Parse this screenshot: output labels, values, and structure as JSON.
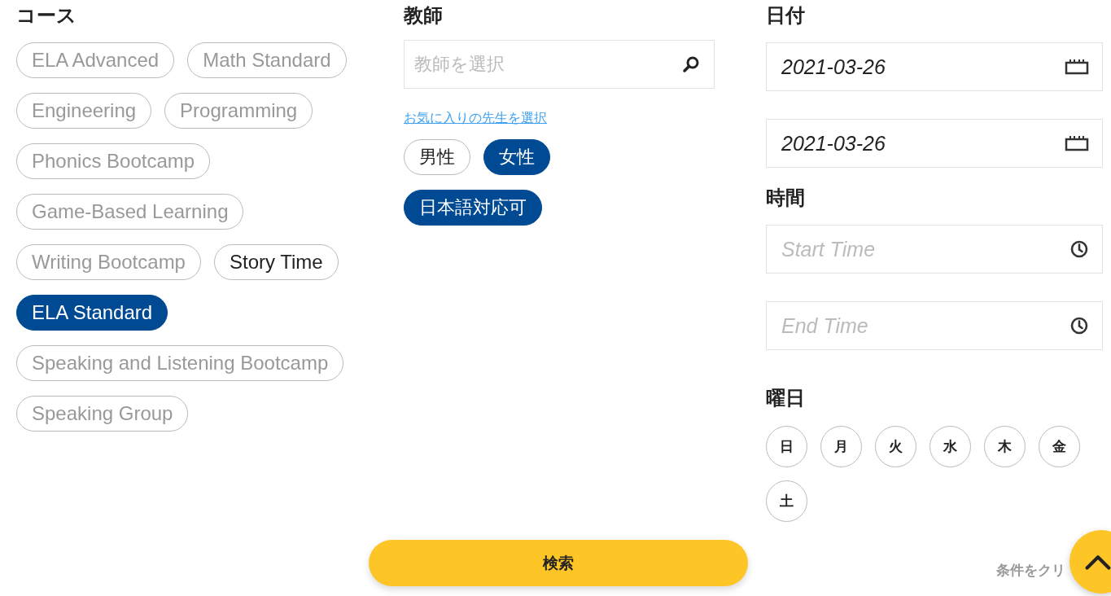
{
  "courses": {
    "heading": "コース",
    "items": [
      {
        "label": "ELA Advanced",
        "selected": false,
        "highlighted": false
      },
      {
        "label": "Math Standard",
        "selected": false,
        "highlighted": false
      },
      {
        "label": "Engineering",
        "selected": false,
        "highlighted": false
      },
      {
        "label": "Programming",
        "selected": false,
        "highlighted": false
      },
      {
        "label": "Phonics Bootcamp",
        "selected": false,
        "highlighted": false
      },
      {
        "label": "Game-Based Learning",
        "selected": false,
        "highlighted": false
      },
      {
        "label": "Writing Bootcamp",
        "selected": false,
        "highlighted": false
      },
      {
        "label": "Story Time",
        "selected": false,
        "highlighted": true
      },
      {
        "label": "ELA Standard",
        "selected": true,
        "highlighted": false
      },
      {
        "label": "Speaking and Listening Bootcamp",
        "selected": false,
        "highlighted": false
      },
      {
        "label": "Speaking Group",
        "selected": false,
        "highlighted": false
      }
    ]
  },
  "teacher": {
    "heading": "教師",
    "search": {
      "placeholder": "教師を選択"
    },
    "favorites_link": "お気に入りの先生を選択",
    "filters": [
      {
        "label": "男性",
        "selected": false
      },
      {
        "label": "女性",
        "selected": true
      },
      {
        "label": "日本語対応可",
        "selected": true
      }
    ]
  },
  "date": {
    "heading": "日付",
    "fields": [
      {
        "value": "2021-03-26"
      },
      {
        "value": "2021-03-26"
      }
    ]
  },
  "time": {
    "heading": "時間",
    "fields": [
      {
        "placeholder": "Start Time"
      },
      {
        "placeholder": "End Time"
      }
    ]
  },
  "weekdays": {
    "heading": "曜日",
    "items": [
      {
        "label": "日",
        "selected": false
      },
      {
        "label": "月",
        "selected": false
      },
      {
        "label": "火",
        "selected": false
      },
      {
        "label": "水",
        "selected": false
      },
      {
        "label": "木",
        "selected": false
      },
      {
        "label": "金",
        "selected": false
      },
      {
        "label": "土",
        "selected": false
      }
    ]
  },
  "search_button": "検索",
  "clear_link": "条件をクリ"
}
